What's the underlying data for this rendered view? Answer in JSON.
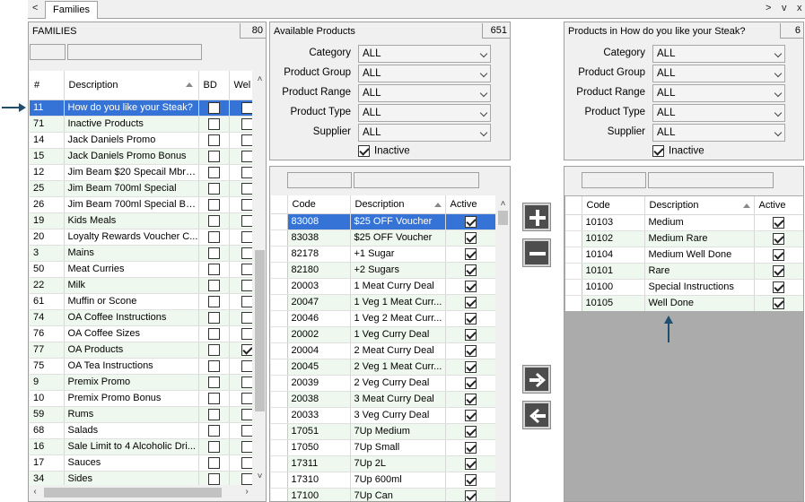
{
  "tabs": {
    "active": "Families",
    "nav_left": "<",
    "nav_right": ">",
    "menu": "v",
    "close": "x"
  },
  "families": {
    "title": "FAMILIES",
    "count": "80",
    "columns": {
      "num": "#",
      "description": "Description",
      "bd": "BD",
      "wel": "Wel"
    },
    "rows": [
      {
        "num": "11",
        "desc": "How do you like your Steak?",
        "bd": false,
        "wel": false,
        "selected": true
      },
      {
        "num": "71",
        "desc": "Inactive Products",
        "bd": false,
        "wel": false
      },
      {
        "num": "14",
        "desc": "Jack Daniels Promo",
        "bd": false,
        "wel": false
      },
      {
        "num": "15",
        "desc": "Jack Daniels Promo Bonus",
        "bd": false,
        "wel": false
      },
      {
        "num": "12",
        "desc": "Jim Beam $20 Specail Mbrs ...",
        "bd": false,
        "wel": false
      },
      {
        "num": "25",
        "desc": "Jim Beam 700ml Special",
        "bd": false,
        "wel": false
      },
      {
        "num": "26",
        "desc": "Jim Beam 700ml Special Bo...",
        "bd": false,
        "wel": false
      },
      {
        "num": "19",
        "desc": "Kids Meals",
        "bd": false,
        "wel": false
      },
      {
        "num": "20",
        "desc": "Loyalty Rewards Voucher C...",
        "bd": false,
        "wel": false
      },
      {
        "num": "3",
        "desc": "Mains",
        "bd": false,
        "wel": false
      },
      {
        "num": "50",
        "desc": "Meat Curries",
        "bd": false,
        "wel": false
      },
      {
        "num": "22",
        "desc": "Milk",
        "bd": false,
        "wel": false
      },
      {
        "num": "61",
        "desc": "Muffin or Scone",
        "bd": false,
        "wel": false
      },
      {
        "num": "74",
        "desc": "OA Coffee Instructions",
        "bd": false,
        "wel": false
      },
      {
        "num": "76",
        "desc": "OA Coffee Sizes",
        "bd": false,
        "wel": false
      },
      {
        "num": "77",
        "desc": "OA Products",
        "bd": false,
        "wel": true
      },
      {
        "num": "75",
        "desc": "OA Tea Instructions",
        "bd": false,
        "wel": false
      },
      {
        "num": "9",
        "desc": "Premix Promo",
        "bd": false,
        "wel": false
      },
      {
        "num": "10",
        "desc": "Premix Promo Bonus",
        "bd": false,
        "wel": false
      },
      {
        "num": "59",
        "desc": "Rums",
        "bd": false,
        "wel": false
      },
      {
        "num": "68",
        "desc": "Salads",
        "bd": false,
        "wel": false
      },
      {
        "num": "16",
        "desc": "Sale Limit to 4 Alcoholic Dri...",
        "bd": false,
        "wel": false
      },
      {
        "num": "17",
        "desc": "Sauces",
        "bd": false,
        "wel": false
      },
      {
        "num": "34",
        "desc": "Sides",
        "bd": false,
        "wel": false
      }
    ]
  },
  "available": {
    "title": "Available Products",
    "count": "651",
    "filters": [
      {
        "label": "Category",
        "value": "ALL"
      },
      {
        "label": "Product Group",
        "value": "ALL"
      },
      {
        "label": "Product Range",
        "value": "ALL"
      },
      {
        "label": "Product Type",
        "value": "ALL"
      },
      {
        "label": "Supplier",
        "value": "ALL"
      }
    ],
    "inactive_label": "Inactive",
    "inactive_checked": true,
    "columns": {
      "code": "Code",
      "description": "Description",
      "active": "Active"
    },
    "rows": [
      {
        "code": "83008",
        "desc": "$25 OFF Voucher",
        "active": true,
        "selected": true
      },
      {
        "code": "83038",
        "desc": "$25 OFF Voucher",
        "active": true
      },
      {
        "code": "82178",
        "desc": "+1 Sugar",
        "active": true
      },
      {
        "code": "82180",
        "desc": "+2 Sugars",
        "active": true
      },
      {
        "code": "20003",
        "desc": "1 Meat Curry Deal",
        "active": true
      },
      {
        "code": "20047",
        "desc": "1 Veg 1 Meat Curr...",
        "active": true
      },
      {
        "code": "20046",
        "desc": "1 Veg 2 Meat Curr...",
        "active": true
      },
      {
        "code": "20002",
        "desc": "1 Veg Curry Deal",
        "active": true
      },
      {
        "code": "20004",
        "desc": "2 Meat Curry Deal",
        "active": true
      },
      {
        "code": "20045",
        "desc": "2 Veg 1 Meat Curr...",
        "active": true
      },
      {
        "code": "20039",
        "desc": "2 Veg Curry Deal",
        "active": true
      },
      {
        "code": "20038",
        "desc": "3 Meat Curry Deal",
        "active": true
      },
      {
        "code": "20033",
        "desc": "3 Veg Curry Deal",
        "active": true
      },
      {
        "code": "17051",
        "desc": "7Up  Medium",
        "active": true
      },
      {
        "code": "17050",
        "desc": "7Up  Small",
        "active": true
      },
      {
        "code": "17311",
        "desc": "7Up 2L",
        "active": true
      },
      {
        "code": "17310",
        "desc": "7Up 600ml",
        "active": true
      },
      {
        "code": "17100",
        "desc": "7Up Can",
        "active": true
      }
    ]
  },
  "assigned": {
    "title": "Products in How do you like your Steak?",
    "count": "6",
    "filters": [
      {
        "label": "Category",
        "value": "ALL"
      },
      {
        "label": "Product Group",
        "value": "ALL"
      },
      {
        "label": "Product Range",
        "value": "ALL"
      },
      {
        "label": "Product Type",
        "value": "ALL"
      },
      {
        "label": "Supplier",
        "value": "ALL"
      }
    ],
    "inactive_label": "Inactive",
    "inactive_checked": true,
    "columns": {
      "code": "Code",
      "description": "Description",
      "active": "Active"
    },
    "rows": [
      {
        "code": "10103",
        "desc": "Medium",
        "active": true
      },
      {
        "code": "10102",
        "desc": "Medium Rare",
        "active": true
      },
      {
        "code": "10104",
        "desc": "Medium Well Done",
        "active": true
      },
      {
        "code": "10101",
        "desc": "Rare",
        "active": true
      },
      {
        "code": "10100",
        "desc": "Special Instructions",
        "active": true
      },
      {
        "code": "10105",
        "desc": "Well Done",
        "active": true
      }
    ]
  },
  "actions": {
    "add_icon": "plus-icon",
    "remove_icon": "minus-icon",
    "move_right_icon": "arrow-right-icon",
    "move_left_icon": "arrow-left-icon"
  },
  "colors": {
    "selection": "#3574d6",
    "alt_row": "#eef8ee",
    "annotation_arrow": "#1f4e6e",
    "button_bg": "#4d4d4d"
  }
}
